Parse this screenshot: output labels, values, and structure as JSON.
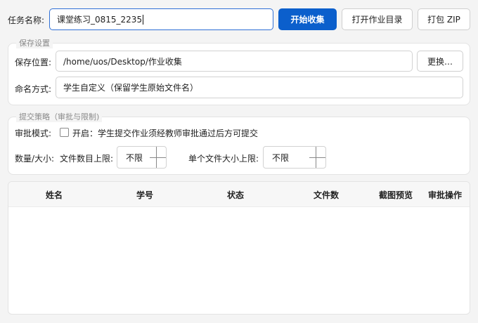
{
  "task": {
    "label": "任务名称:",
    "value": "课堂练习_0815_2235",
    "start_button": "开始收集",
    "open_dir_button": "打开作业目录",
    "zip_button": "打包 ZIP"
  },
  "save_settings": {
    "title": "保存设置",
    "location_label": "保存位置:",
    "location_value": "/home/uos/Desktop/作业收集",
    "change_button": "更换…",
    "naming_label": "命名方式:",
    "naming_value": "学生自定义（保留学生原始文件名）"
  },
  "policy": {
    "title": "提交策略（审批与限制)",
    "approval_label": "审批模式:",
    "approval_checked": false,
    "approval_text": "开启：学生提交作业须经教师审批通过后方可提交",
    "limits_label": "数量/大小:",
    "file_count_label": "文件数目上限:",
    "file_count_value": "不限",
    "file_size_label": "单个文件大小上限:",
    "file_size_value": "不限"
  },
  "table": {
    "columns": [
      "姓名",
      "学号",
      "状态",
      "文件数",
      "截图预览",
      "审批操作"
    ],
    "rows": []
  }
}
